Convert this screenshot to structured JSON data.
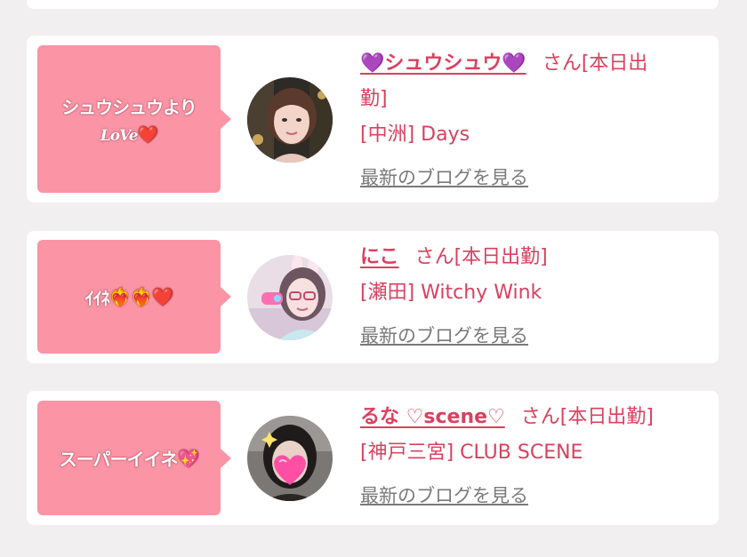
{
  "cards": [
    {
      "message": {
        "line1": "シュウシュウより",
        "line2_love": "LoVe",
        "line2_heart": "❤️"
      },
      "avatar_icon": "woman-portrait",
      "name": {
        "heart_left": "💜",
        "text": "シュウシュウ",
        "heart_right": "💜"
      },
      "san": "さん[本日出",
      "san2": "勤]",
      "shop": "[中洲] Days",
      "blog_link": "最新のブログを見る"
    },
    {
      "message": {
        "text": "ｲｲﾈ",
        "emoji": "❤️‍🔥❤️‍🔥❤️"
      },
      "avatar_icon": "girl-with-bunny-ears-portrait",
      "name": {
        "text": "にこ"
      },
      "san": "さん[本日出勤]",
      "shop": "[瀬田] Witchy Wink",
      "blog_link": "最新のブログを見る"
    },
    {
      "message": {
        "text": "スーパーイイネ",
        "emoji": "💖"
      },
      "avatar_icon": "heart-covered-face-portrait",
      "name": {
        "text": "るな ♡scene♡"
      },
      "san": "さん[本日出勤]",
      "shop": "[神戸三宮] CLUB SCENE",
      "blog_link": "最新のブログを見る"
    }
  ]
}
